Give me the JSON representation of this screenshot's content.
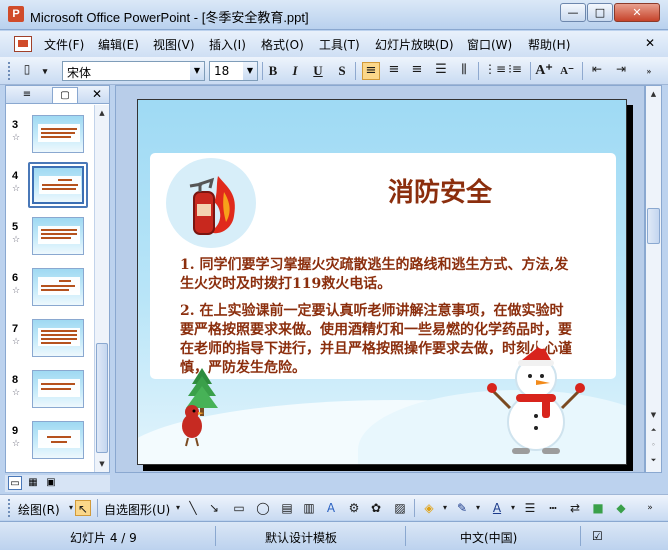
{
  "window": {
    "title": "Microsoft Office PowerPoint - [冬季安全教育.ppt]",
    "app_icon": "P",
    "controls": {
      "minimize": "—",
      "maximize": "□",
      "close": "✕"
    }
  },
  "menu": {
    "items": [
      "文件(F)",
      "编辑(E)",
      "视图(V)",
      "插入(I)",
      "格式(O)",
      "工具(T)",
      "幻灯片放映(D)",
      "窗口(W)",
      "帮助(H)"
    ],
    "close_glyph": "✕"
  },
  "toolbar": {
    "font_name": "宋体",
    "font_size": "18",
    "bold": "B",
    "italic": "I",
    "underline": "U",
    "shadow": "S",
    "grow_font": "A⁺",
    "shrink_font": "A⁻"
  },
  "slide_pane": {
    "tabs": [
      {
        "icon": "outline-icon",
        "glyph": "≡"
      },
      {
        "icon": "slides-icon",
        "glyph": "▢"
      }
    ],
    "close_glyph": "✕",
    "thumbnails": [
      {
        "number": "3",
        "selected": false
      },
      {
        "number": "4",
        "selected": true
      },
      {
        "number": "5",
        "selected": false
      },
      {
        "number": "6",
        "selected": false
      },
      {
        "number": "7",
        "selected": false
      },
      {
        "number": "8",
        "selected": false
      },
      {
        "number": "9",
        "selected": false
      }
    ],
    "star_glyph": "☆"
  },
  "slide": {
    "title": "消防安全",
    "paragraph1": "1. 同学们要学习掌握火灾疏散逃生的路线和逃生方式、方法,发生火灾时及时拨打119救火电话。",
    "paragraph2": "2. 在上实验课前一定要认真听老师讲解注意事项，在做实验时要严格按照要求来做。使用酒精灯和一些易燃的化学药品时，要在老师的指导下进行，并且严格按照操作要求去做，时刻小心谨慎，严防发生危险。",
    "text_color": "#8b2e0d",
    "background_color": "#9fdaf4"
  },
  "drawing_toolbar": {
    "draw": "绘图(R)",
    "autoshapes": "自选图形(U)"
  },
  "status": {
    "slide_position": "幻灯片 4 / 9",
    "design": "默认设计模板",
    "language": "中文(中国)"
  }
}
